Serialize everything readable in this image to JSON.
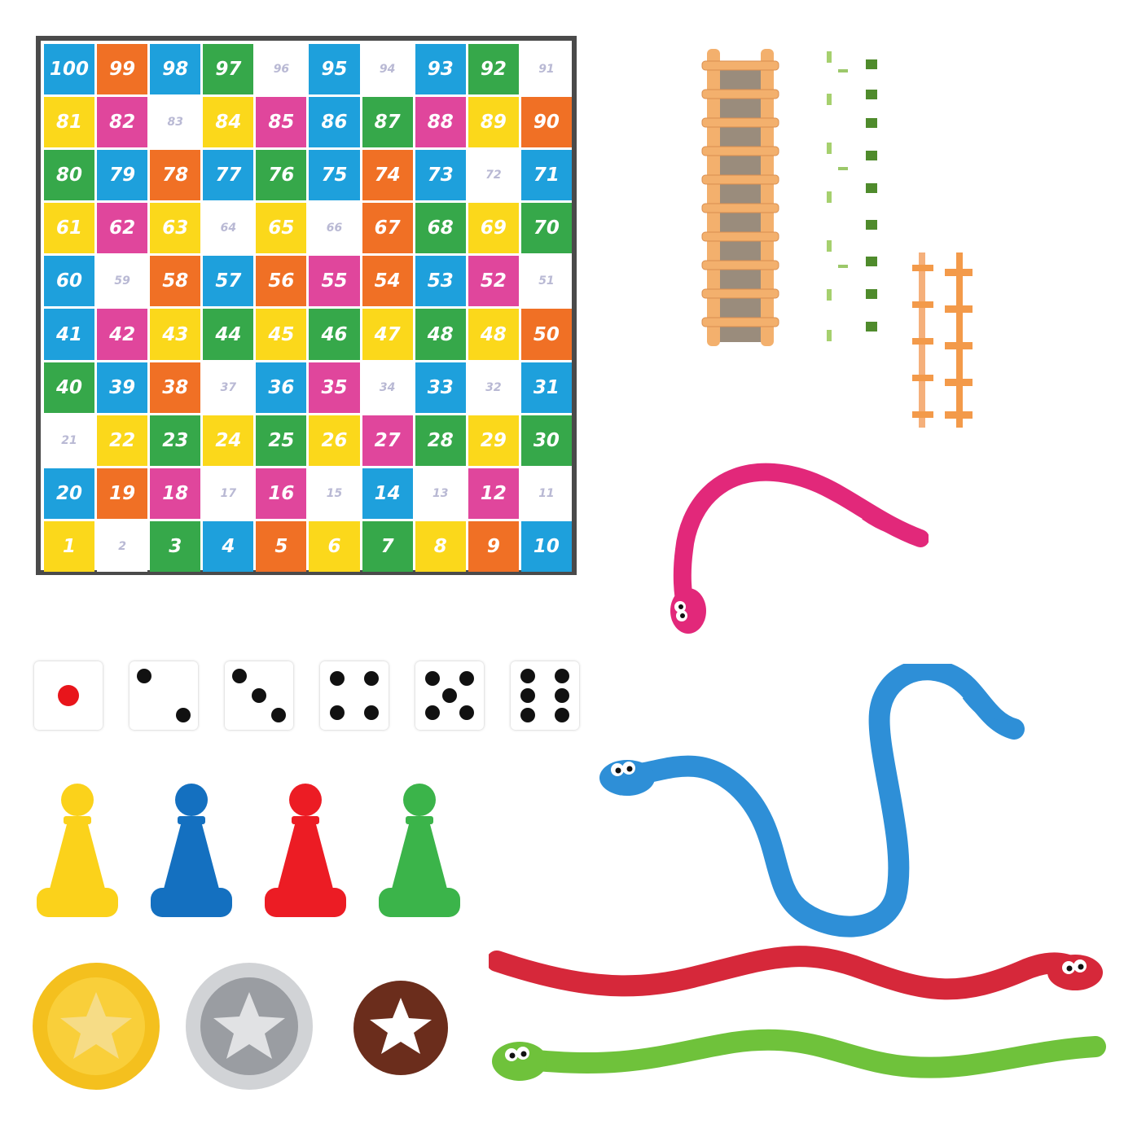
{
  "board": {
    "colors": {
      "B": "#1ea0dc",
      "O": "#f07025",
      "G": "#36a84a",
      "Y": "#fbd81b",
      "W": "#ffffff",
      "P": "#e0469c"
    },
    "rows": [
      {
        "numbers": [
          100,
          99,
          98,
          97,
          96,
          95,
          94,
          93,
          92,
          91
        ],
        "colors": "BOBGWBWBGW"
      },
      {
        "numbers": [
          81,
          82,
          83,
          84,
          85,
          86,
          87,
          88,
          89,
          90
        ],
        "colors": "YPWYPBGPYO"
      },
      {
        "numbers": [
          80,
          79,
          78,
          77,
          76,
          75,
          74,
          73,
          72,
          71
        ],
        "colors": "GBOBGBOBWB"
      },
      {
        "numbers": [
          61,
          62,
          63,
          64,
          65,
          66,
          67,
          68,
          69,
          70
        ],
        "colors": "YPYWYWOGYG"
      },
      {
        "numbers": [
          60,
          59,
          58,
          57,
          56,
          55,
          54,
          53,
          52,
          51
        ],
        "colors": "BWOBOPOBPW"
      },
      {
        "numbers": [
          41,
          42,
          43,
          44,
          45,
          46,
          47,
          48,
          48,
          50
        ],
        "colors": "BPYGYGYGYO"
      },
      {
        "numbers": [
          40,
          39,
          38,
          37,
          36,
          35,
          34,
          33,
          32,
          31
        ],
        "colors": "GBOWBPWBWB"
      },
      {
        "numbers": [
          21,
          22,
          23,
          24,
          25,
          26,
          27,
          28,
          29,
          30
        ],
        "colors": "WYGYGYPGYG"
      },
      {
        "numbers": [
          20,
          19,
          18,
          17,
          16,
          15,
          14,
          13,
          12,
          11
        ],
        "colors": "BOPWPWBWPW"
      },
      {
        "numbers": [
          1,
          2,
          3,
          4,
          5,
          6,
          7,
          8,
          9,
          10
        ],
        "colors": "YWGBOYGYOB"
      }
    ]
  },
  "dice": [
    1,
    2,
    3,
    4,
    5,
    6
  ],
  "dice_colors": {
    "one": "#e8151b",
    "pip": "#111111"
  },
  "pawn_colors": {
    "yellow": "#fbd21b",
    "blue": "#1470c0",
    "red": "#ec1c24",
    "green": "#3bb44a"
  },
  "coin_colors": {
    "gold": "#f4c01e",
    "silver": "#b9bcc0",
    "bronze": "#6b2d1c"
  },
  "snake_colors": {
    "pink": "#e2287a",
    "blue": "#2e8fd7",
    "red": "#d6283a",
    "green": "#6fc23b"
  },
  "ladder_colors": {
    "wood": "#f3b06d",
    "green": "#4f8b2c",
    "orange": "#f39a4a"
  }
}
